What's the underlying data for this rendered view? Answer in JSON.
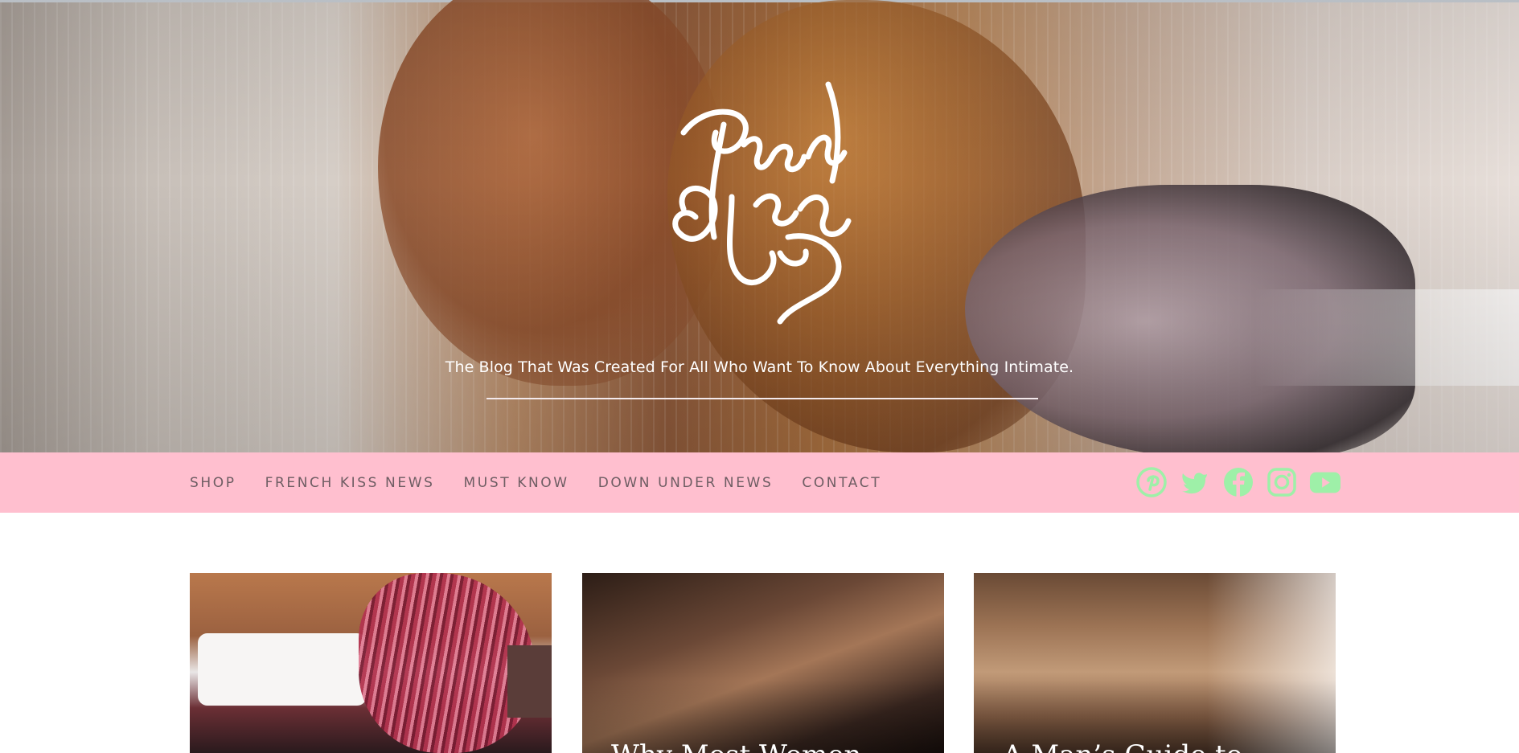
{
  "header": {
    "brand_name": "French Kiss",
    "tagline": "The Blog That Was Created For All Who Want To Know About Everything Intimate."
  },
  "nav": {
    "items": [
      {
        "label": "SHOP"
      },
      {
        "label": "FRENCH KISS NEWS"
      },
      {
        "label": "MUST KNOW"
      },
      {
        "label": "DOWN UNDER NEWS"
      },
      {
        "label": "CONTACT"
      }
    ],
    "social": [
      {
        "icon": "pinterest-icon"
      },
      {
        "icon": "twitter-icon"
      },
      {
        "icon": "facebook-icon"
      },
      {
        "icon": "instagram-icon"
      },
      {
        "icon": "youtube-icon"
      }
    ]
  },
  "cards": [
    {
      "title": ""
    },
    {
      "title": "Why Most Women"
    },
    {
      "title": "A Man’s Guide to"
    }
  ],
  "colors": {
    "nav_bg": "#ffbfcf",
    "nav_text": "#6e5d63",
    "social_icon": "#9ef0a8",
    "tagline": "#ffffff"
  }
}
